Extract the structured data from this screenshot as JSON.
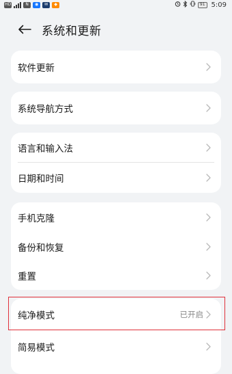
{
  "status_bar": {
    "left_chip_1": "HD",
    "left_chip_2": "N",
    "left_chip_3": "◉",
    "left_chip_4": "✉",
    "left_chip_5": "◆",
    "battery": "91",
    "time": "5:09"
  },
  "header": {
    "title": "系统和更新",
    "back_icon": "back-arrow-icon"
  },
  "groups": [
    {
      "items": [
        {
          "label": "软件更新",
          "value": ""
        }
      ]
    },
    {
      "items": [
        {
          "label": "系统导航方式",
          "value": ""
        }
      ]
    },
    {
      "items": [
        {
          "label": "语言和输入法",
          "value": ""
        },
        {
          "label": "日期和时间",
          "value": ""
        }
      ]
    },
    {
      "items": [
        {
          "label": "手机克隆",
          "value": ""
        },
        {
          "label": "备份和恢复",
          "value": ""
        },
        {
          "label": "重置",
          "value": ""
        }
      ]
    },
    {
      "items": [
        {
          "label": "纯净模式",
          "value": "已开启"
        },
        {
          "label": "简易模式",
          "value": ""
        }
      ]
    }
  ],
  "colors": {
    "background": "#f1f3f5",
    "card": "#ffffff",
    "highlight": "#e0303a",
    "secondary_text": "#8a8a8a"
  }
}
